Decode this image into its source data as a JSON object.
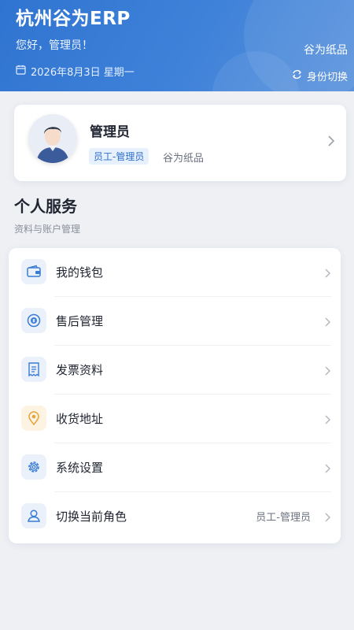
{
  "header": {
    "app_title": "杭州谷为ERP",
    "greeting": "您好，管理员！",
    "date": "2026年8月3日 星期一",
    "company": "谷为纸品",
    "switch_identity": "身份切换",
    "icons": {
      "date": "calendar-icon",
      "switch": "swap-icon"
    }
  },
  "profile": {
    "name": "管理员",
    "role_tag": "员工-管理员",
    "company": "谷为纸品",
    "icon": "avatar-icon"
  },
  "section": {
    "title": "个人服务",
    "subtitle": "资料与账户管理"
  },
  "menu": {
    "items": [
      {
        "label": "我的钱包",
        "icon": "wallet-icon"
      },
      {
        "label": "售后管理",
        "icon": "after-sales-icon"
      },
      {
        "label": "发票资料",
        "icon": "invoice-icon"
      },
      {
        "label": "收货地址",
        "icon": "location-pin-icon"
      },
      {
        "label": "系统设置",
        "icon": "gear-icon"
      },
      {
        "label": "切换当前角色",
        "icon": "user-icon",
        "value": "员工-管理员"
      }
    ]
  },
  "colors": {
    "header_gradient_start": "#2f74d0",
    "header_gradient_end": "#5a93dc",
    "accent": "#2f6fcb",
    "background": "#eef0f4"
  }
}
